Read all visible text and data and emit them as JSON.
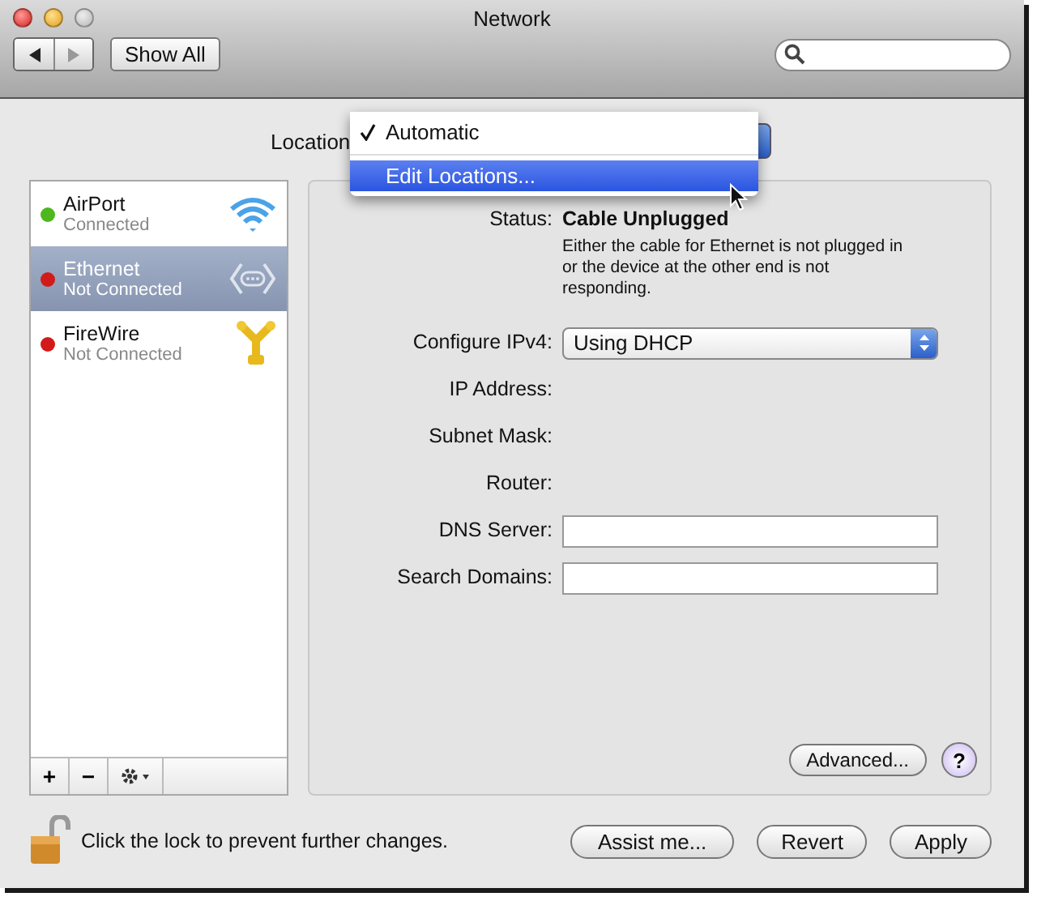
{
  "window": {
    "title": "Network"
  },
  "toolbar": {
    "show_all": "Show All"
  },
  "location": {
    "label": "Location",
    "menu": [
      {
        "label": "Automatic",
        "checked": true,
        "selected": false
      },
      {
        "label": "Edit Locations...",
        "checked": false,
        "selected": true
      }
    ]
  },
  "services": [
    {
      "name": "AirPort",
      "status": "Connected",
      "color": "#4cb81e",
      "selected": false,
      "kind": "wifi"
    },
    {
      "name": "Ethernet",
      "status": "Not Connected",
      "color": "#d21a1a",
      "selected": true,
      "kind": "ethernet"
    },
    {
      "name": "FireWire",
      "status": "Not Connected",
      "color": "#d21a1a",
      "selected": false,
      "kind": "firewire"
    }
  ],
  "sidebar_buttons": [
    "+",
    "−"
  ],
  "detail": {
    "status_label": "Status:",
    "status": "Cable Unplugged",
    "status_note": "Either the cable for Ethernet is not plugged in or the device at the other end is not responding.",
    "fields": [
      {
        "label": "Configure IPv4:",
        "kind": "popup",
        "value": "Using DHCP"
      },
      {
        "label": "IP Address:",
        "kind": "text"
      },
      {
        "label": "Subnet Mask:",
        "kind": "text"
      },
      {
        "label": "Router:",
        "kind": "text"
      },
      {
        "label": "DNS Server:",
        "kind": "input"
      },
      {
        "label": "Search Domains:",
        "kind": "input"
      }
    ],
    "advanced": "Advanced...",
    "help": "?"
  },
  "footer": {
    "lock_text": "Click the lock to prevent further changes.",
    "buttons": [
      "Assist me...",
      "Revert",
      "Apply"
    ]
  }
}
